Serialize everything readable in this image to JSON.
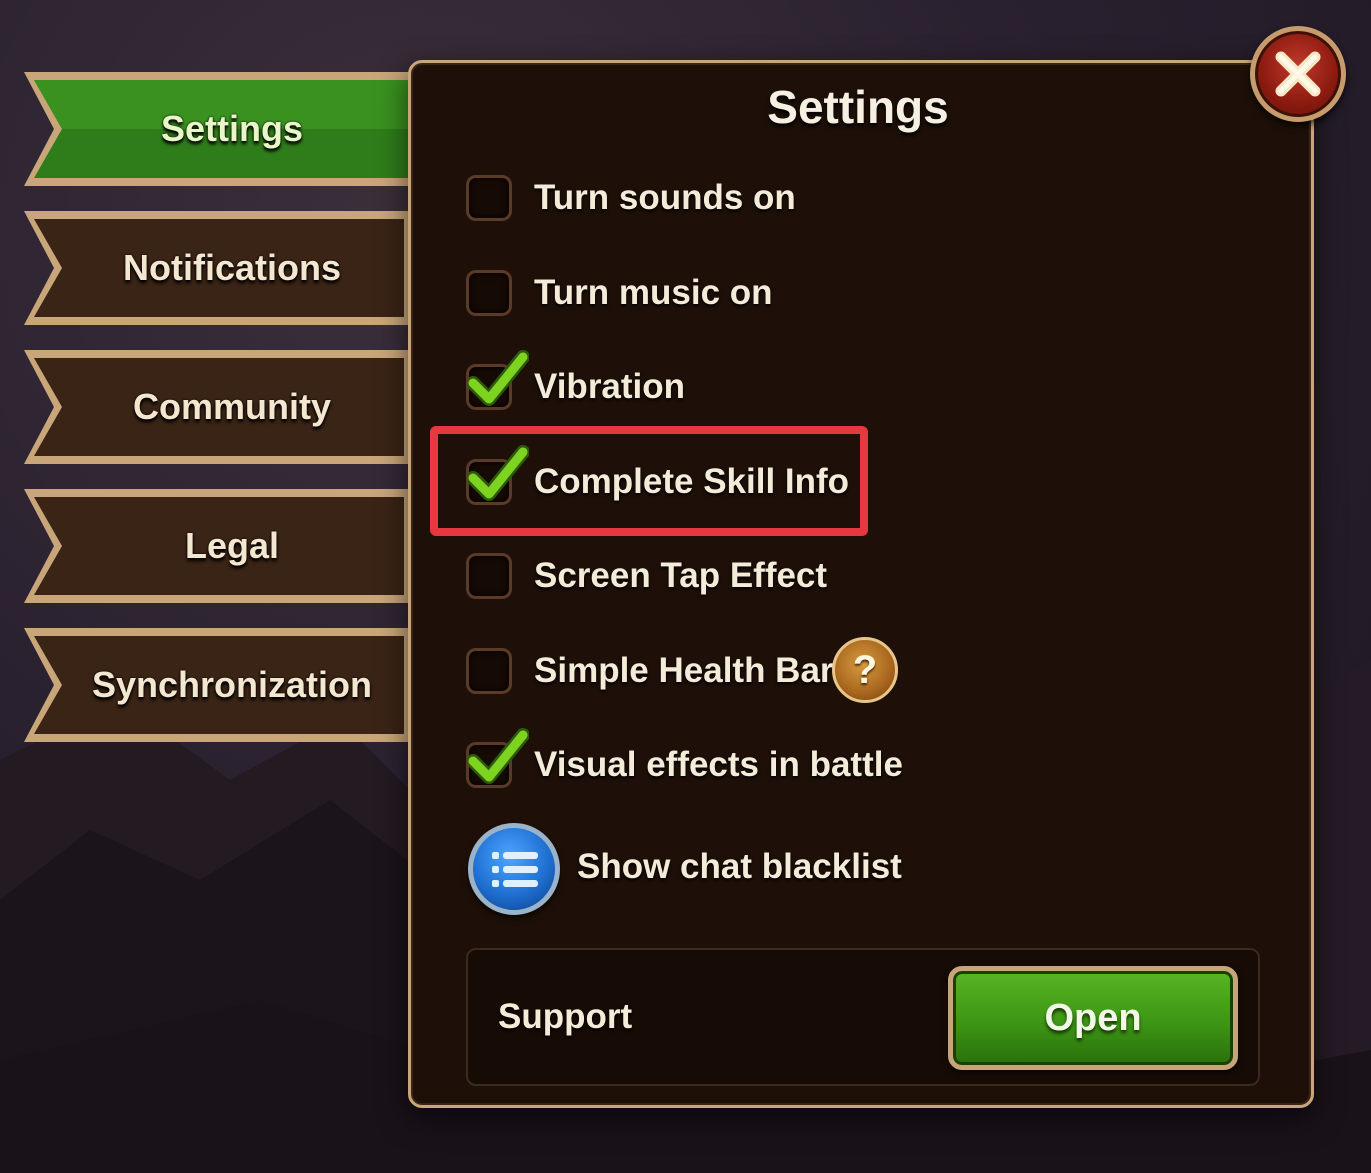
{
  "tabs": [
    {
      "label": "Settings",
      "active": true
    },
    {
      "label": "Notifications",
      "active": false
    },
    {
      "label": "Community",
      "active": false
    },
    {
      "label": "Legal",
      "active": false
    },
    {
      "label": "Synchronization",
      "active": false
    }
  ],
  "panel": {
    "title": "Settings"
  },
  "options": [
    {
      "label": "Turn sounds on",
      "checked": false
    },
    {
      "label": "Turn music on",
      "checked": false
    },
    {
      "label": "Vibration",
      "checked": true
    },
    {
      "label": "Complete Skill Info",
      "checked": true
    },
    {
      "label": "Screen Tap Effect",
      "checked": false
    },
    {
      "label": "Simple Health Bar",
      "checked": false
    },
    {
      "label": "Visual effects in battle",
      "checked": true
    }
  ],
  "help_icon": {
    "glyph": "?"
  },
  "blacklist": {
    "label": "Show chat blacklist",
    "icon": "list-icon"
  },
  "support": {
    "label": "Support",
    "button_label": "Open"
  },
  "colors": {
    "active_tab": "#2f7d1a",
    "inactive_tab": "#3a2416",
    "tab_border": "#c9a67a",
    "panel_bg": "#1e1009",
    "check_green": "#7ed321",
    "highlight_red": "#e8383f",
    "open_button": "#3d9615"
  }
}
